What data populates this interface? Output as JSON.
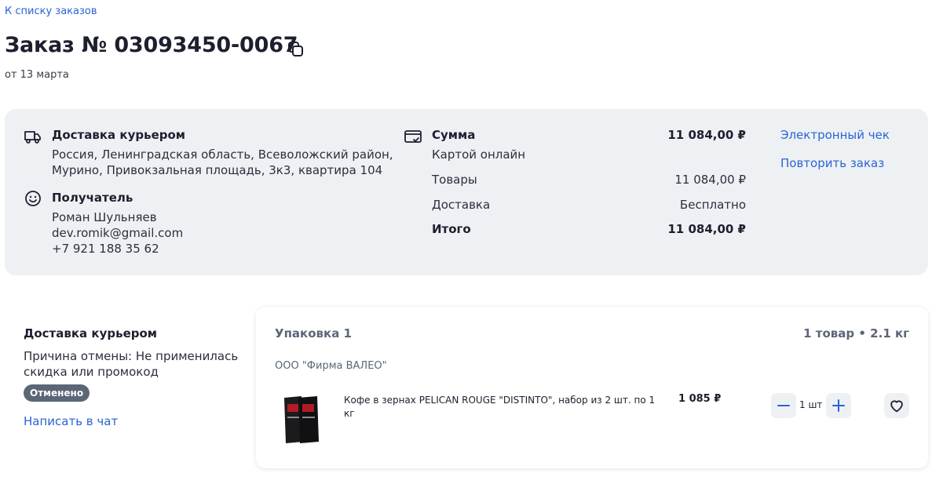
{
  "header": {
    "back_link": "К списку заказов",
    "title": "Заказ № 03093450-0067",
    "date": "от 13 марта"
  },
  "delivery": {
    "title": "Доставка курьером",
    "address_line1": "Россия, Ленинградская область, Всеволожский район,",
    "address_line2": "Мурино, Привокзальная площадь, 3к3, квартира 104"
  },
  "recipient": {
    "title": "Получатель",
    "name": "Роман Шульняев",
    "email": "dev.romik@gmail.com",
    "phone": "+7 921 188 35 62"
  },
  "payment": {
    "sum_label": "Сумма",
    "sum_value": "11 084,00 ₽",
    "method": "Картой онлайн",
    "goods_label": "Товары",
    "goods_value": "11 084,00 ₽",
    "delivery_label": "Доставка",
    "delivery_value": "Бесплатно",
    "total_label": "Итого",
    "total_value": "11 084,00 ₽"
  },
  "actions": {
    "receipt": "Электронный чек",
    "repeat": "Повторить заказ"
  },
  "shipment": {
    "title": "Доставка курьером",
    "reason_line1": "Причина отмены: Не применилась",
    "reason_line2": "скидка или промокод",
    "status": "Отменено",
    "chat_link": "Написать в чат"
  },
  "package": {
    "title": "Упаковка 1",
    "summary": "1 товар • 2.1 кг",
    "seller": "ООО \"Фирма ВАЛЕО\"",
    "item": {
      "name_line1": "Кофе в зернах PELICAN ROUGE \"DISTINTO\", набор из 2 шт. по 1",
      "name_line2": "кг",
      "price": "1 085 ₽",
      "quantity": "1 шт"
    }
  },
  "colors": {
    "accent": "#2a63d4",
    "panel_bg": "#eef1f4",
    "badge_bg": "#5b6677"
  }
}
